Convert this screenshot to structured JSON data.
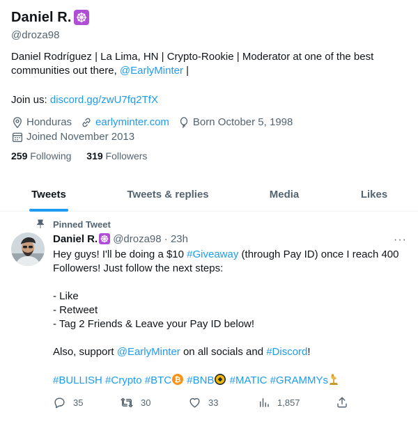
{
  "profile": {
    "display_name": "Daniel R.",
    "handle": "@droza98",
    "bio_line1": "Daniel Rodríguez | La Lima, HN | Crypto-Rookie | Moderator at one of the best",
    "bio_line2_text": "communities out there, ",
    "bio_mention": "@EarlyMinter",
    "bio_line2_end": " |",
    "join_label": "Join us: ",
    "join_link": "discord.gg/zwU7fq2TfX",
    "location": "Honduras",
    "website": "earlyminter.com",
    "born": "Born October 5, 1998",
    "joined": "Joined November 2013",
    "following_count": "259",
    "following_label": " Following",
    "followers_count": "319",
    "followers_label": " Followers"
  },
  "tabs": [
    {
      "label": "Tweets",
      "active": true
    },
    {
      "label": "Tweets & replies",
      "active": false
    },
    {
      "label": "Media",
      "active": false
    },
    {
      "label": "Likes",
      "active": false
    }
  ],
  "tweet": {
    "pinned_label": "Pinned Tweet",
    "author": "Daniel R.",
    "handle_time": "@droza98 · 23h",
    "more": "···",
    "line1_a": "Hey guys! I'll be doing a $10 ",
    "line1_tag": "#Giveaway",
    "line1_b": " (through Pay ID) once I reach 400",
    "line2": "Followers! Just follow the next steps:",
    "step1": "- Like",
    "step2": "- Retweet",
    "step3": "- Tag 2 Friends & Leave your Pay ID below!",
    "support_a": "Also, support ",
    "support_mention": "@EarlyMinter",
    "support_b": " on all socials and ",
    "support_tag": "#Discord",
    "support_c": "!",
    "tags": [
      "#BULLISH",
      "#Crypto",
      "#BTC",
      "#BNB",
      "#MATIC",
      "#GRAMMYs"
    ],
    "replies": "35",
    "retweets": "30",
    "likes": "33",
    "views": "1,857"
  },
  "colors": {
    "accent": "#1d9bf0",
    "badge": "#b04fd6",
    "muted": "#536471",
    "text": "#0f1419"
  },
  "icons": [
    "wheel-badge-icon",
    "location-icon",
    "link-icon",
    "balloon-icon",
    "calendar-icon",
    "pin-icon",
    "reply-icon",
    "retweet-icon",
    "like-icon",
    "views-icon",
    "share-icon",
    "bitcoin-emoji-icon",
    "bnb-emoji-icon",
    "grammy-emoji-icon"
  ]
}
